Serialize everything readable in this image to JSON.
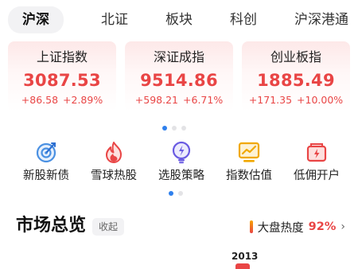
{
  "tabs": [
    {
      "label": "沪深",
      "active": true
    },
    {
      "label": "北证",
      "active": false
    },
    {
      "label": "板块",
      "active": false
    },
    {
      "label": "科创",
      "active": false
    },
    {
      "label": "沪深港通",
      "active": false
    }
  ],
  "indices": [
    {
      "name": "上证指数",
      "value": "3087.53",
      "change": "+86.58",
      "change_pct": "+2.89%"
    },
    {
      "name": "深证成指",
      "value": "9514.86",
      "change": "+598.21",
      "change_pct": "+6.71%"
    },
    {
      "name": "创业板指",
      "value": "1885.49",
      "change": "+171.35",
      "change_pct": "+10.00%"
    }
  ],
  "shortcuts": [
    {
      "label": "新股新债",
      "icon": "target-icon"
    },
    {
      "label": "雪球热股",
      "icon": "flame-icon"
    },
    {
      "label": "选股策略",
      "icon": "lightbulb-icon"
    },
    {
      "label": "指数估值",
      "icon": "trend-chart-icon"
    },
    {
      "label": "低佣开户",
      "icon": "wallet-icon"
    }
  ],
  "market": {
    "title": "市场总览",
    "collapse_label": "收起",
    "heat_label": "大盘热度",
    "heat_value": "92%",
    "heat_chevron": "›",
    "year_label": "2013"
  },
  "colors": {
    "up": "#e94545",
    "accent": "#2f80ed"
  }
}
